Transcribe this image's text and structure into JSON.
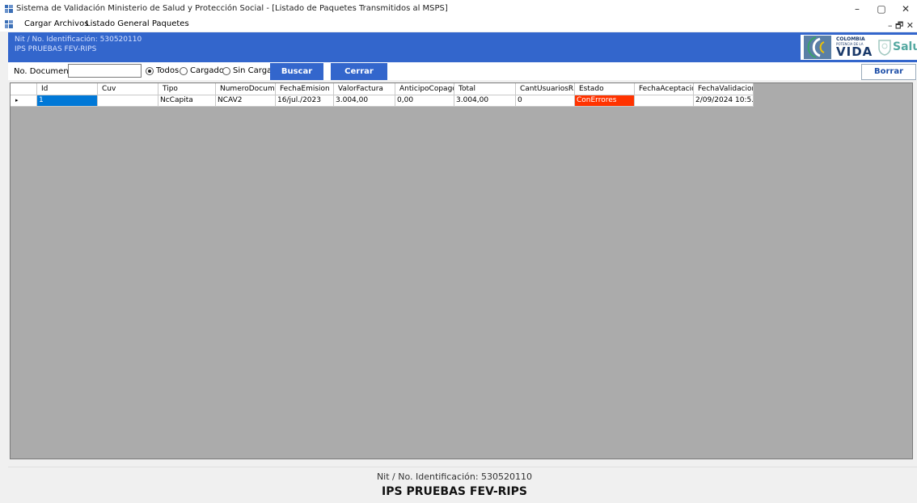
{
  "window": {
    "title": "Sistema de Validación Ministerio de Salud y Protección Social - [Listado de Paquetes Transmitidos al MSPS]",
    "minimize": "–",
    "maximize": "▢",
    "close": "✕",
    "icon": "app-window-icon"
  },
  "menu": {
    "items": [
      "Cargar Archivos",
      "Listado General Paquetes"
    ],
    "mdi_controls": "– 🗗 ✕"
  },
  "banner": {
    "nit": "Nit / No. Identificación: 530520110",
    "ips": "IPS PRUEBAS FEV-RIPS",
    "color": "#3366cc"
  },
  "logo": {
    "colombia": "COLOMBIA",
    "potencia": "POTENCIA DE LA",
    "vida": "VIDA",
    "salud": "Salud"
  },
  "filters": {
    "doc_label": "No. Documento:",
    "doc_value": "",
    "radio_todos": "Todos",
    "radio_cargados": "Cargados",
    "radio_sin_cargar": "Sin Cargar",
    "selected": "Todos",
    "buscar": "Buscar",
    "cerrar": "Cerrar",
    "borrar": "Borrar Datos"
  },
  "table": {
    "columns": [
      "Id",
      "Cuv",
      "Tipo",
      "NumeroDocumen",
      "FechaEmision",
      "ValorFactura",
      "AnticipoCopagoC",
      "Total",
      "CantUsuariosRips",
      "Estado",
      "FechaAceptacion",
      "FechaValidacion"
    ],
    "rows": [
      [
        "1",
        "",
        "NcCapita",
        "NCAV2",
        "16/jul./2023",
        "3.004,00",
        "0,00",
        "3.004,00",
        "0",
        "ConErrores",
        "",
        "2/09/2024 10:5..."
      ]
    ],
    "row_marker": "▸",
    "error_color": "#ff3300",
    "selection_color": "#0078d7"
  },
  "footer": {
    "nit": "Nit / No. Identificación: 530520110",
    "ips": "IPS PRUEBAS FEV-RIPS"
  }
}
